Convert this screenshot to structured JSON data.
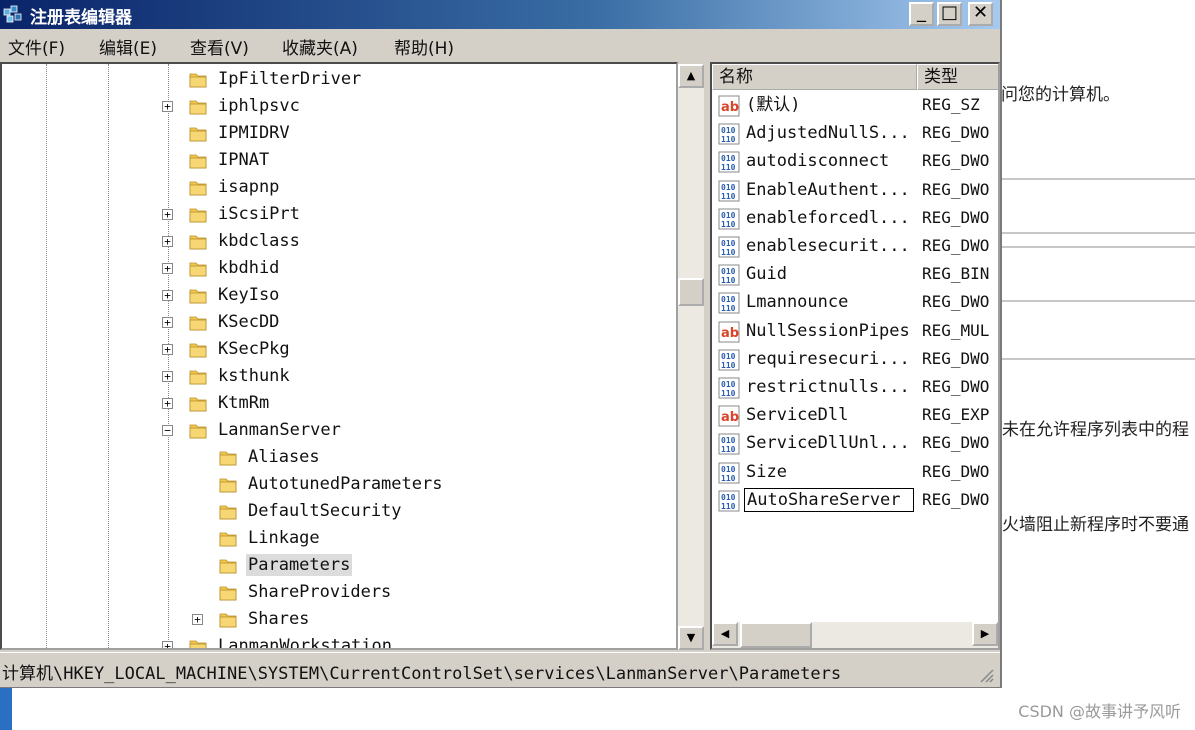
{
  "window": {
    "title": "注册表编辑器",
    "minimize_glyph": "_",
    "maximize_glyph": "□",
    "close_glyph": "✕"
  },
  "menu": [
    "文件(F)",
    "编辑(E)",
    "查看(V)",
    "收藏夹(A)",
    "帮助(H)"
  ],
  "tree": {
    "items": [
      {
        "label": "IpFilterDriver",
        "expandable": false,
        "level": 1
      },
      {
        "label": "iphlpsvc",
        "expandable": true,
        "level": 1
      },
      {
        "label": "IPMIDRV",
        "expandable": false,
        "level": 1
      },
      {
        "label": "IPNAT",
        "expandable": false,
        "level": 1
      },
      {
        "label": "isapnp",
        "expandable": false,
        "level": 1
      },
      {
        "label": "iScsiPrt",
        "expandable": true,
        "level": 1
      },
      {
        "label": "kbdclass",
        "expandable": true,
        "level": 1
      },
      {
        "label": "kbdhid",
        "expandable": true,
        "level": 1
      },
      {
        "label": "KeyIso",
        "expandable": true,
        "level": 1
      },
      {
        "label": "KSecDD",
        "expandable": true,
        "level": 1
      },
      {
        "label": "KSecPkg",
        "expandable": true,
        "level": 1
      },
      {
        "label": "ksthunk",
        "expandable": true,
        "level": 1
      },
      {
        "label": "KtmRm",
        "expandable": true,
        "level": 1
      },
      {
        "label": "LanmanServer",
        "expandable": true,
        "expanded": true,
        "level": 1
      },
      {
        "label": "Aliases",
        "expandable": false,
        "level": 2
      },
      {
        "label": "AutotunedParameters",
        "expandable": false,
        "level": 2
      },
      {
        "label": "DefaultSecurity",
        "expandable": false,
        "level": 2
      },
      {
        "label": "Linkage",
        "expandable": false,
        "level": 2
      },
      {
        "label": "Parameters",
        "expandable": false,
        "level": 2,
        "selected": true
      },
      {
        "label": "ShareProviders",
        "expandable": false,
        "level": 2
      },
      {
        "label": "Shares",
        "expandable": true,
        "level": 2
      },
      {
        "label": "LanmanWorkstation",
        "expandable": true,
        "level": 1
      }
    ]
  },
  "list": {
    "columns": {
      "name": "名称",
      "type": "类型"
    },
    "rows": [
      {
        "name": "(默认)",
        "type": "REG_SZ",
        "icon": "string-value-icon"
      },
      {
        "name": "AdjustedNullS...",
        "type": "REG_DWO",
        "icon": "binary-value-icon"
      },
      {
        "name": "autodisconnect",
        "type": "REG_DWO",
        "icon": "binary-value-icon"
      },
      {
        "name": "EnableAuthent...",
        "type": "REG_DWO",
        "icon": "binary-value-icon"
      },
      {
        "name": "enableforcedl...",
        "type": "REG_DWO",
        "icon": "binary-value-icon"
      },
      {
        "name": "enablesecurit...",
        "type": "REG_DWO",
        "icon": "binary-value-icon"
      },
      {
        "name": "Guid",
        "type": "REG_BIN",
        "icon": "binary-value-icon"
      },
      {
        "name": "Lmannounce",
        "type": "REG_DWO",
        "icon": "binary-value-icon"
      },
      {
        "name": "NullSessionPipes",
        "type": "REG_MUL",
        "icon": "string-value-icon"
      },
      {
        "name": "requiresecuri...",
        "type": "REG_DWO",
        "icon": "binary-value-icon"
      },
      {
        "name": "restrictnulls...",
        "type": "REG_DWO",
        "icon": "binary-value-icon"
      },
      {
        "name": "ServiceDll",
        "type": "REG_EXP",
        "icon": "string-value-icon"
      },
      {
        "name": "ServiceDllUnl...",
        "type": "REG_DWO",
        "icon": "binary-value-icon"
      },
      {
        "name": "Size",
        "type": "REG_DWO",
        "icon": "binary-value-icon"
      },
      {
        "name": "AutoShareServer",
        "type": "REG_DWO",
        "icon": "binary-value-icon",
        "editing": true
      }
    ]
  },
  "statusbar": {
    "path": "计算机\\HKEY_LOCAL_MACHINE\\SYSTEM\\CurrentControlSet\\services\\LanmanServer\\Parameters"
  },
  "background": {
    "text1": "访问您的计算机。",
    "text2": "未在允许程序列表中的程",
    "text3": "火墙阻止新程序时不要通"
  },
  "watermark": "CSDN @故事讲予风听",
  "colors": {
    "titlebar_start": "#0a246a",
    "titlebar_end": "#a6caf0",
    "chrome": "#d4d0c8",
    "folder": "#f2c94c",
    "string_icon": "#d9452b",
    "binary_icon": "#2a5db0"
  }
}
